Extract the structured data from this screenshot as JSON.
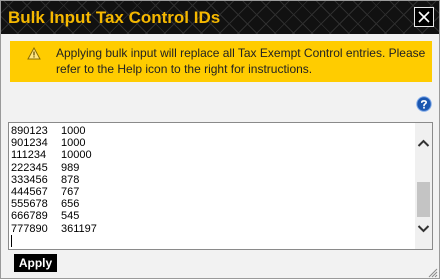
{
  "dialog": {
    "title": "Bulk Input Tax Control IDs",
    "close_icon": "close-icon"
  },
  "warning": {
    "icon": "warning-icon",
    "message": "Applying bulk input will replace all Tax Exempt Control entries. Please refer to the Help icon to the right for instructions."
  },
  "help": {
    "icon": "help-icon"
  },
  "entries": [
    {
      "id": "890123",
      "value": "1000"
    },
    {
      "id": "901234",
      "value": "1000"
    },
    {
      "id": "111234",
      "value": "10000"
    },
    {
      "id": "222345",
      "value": "989"
    },
    {
      "id": "333456",
      "value": "878"
    },
    {
      "id": "444567",
      "value": "767"
    },
    {
      "id": "555678",
      "value": "656"
    },
    {
      "id": "666789",
      "value": "545"
    },
    {
      "id": "777890",
      "value": "361197"
    }
  ],
  "scrollbar": {
    "up_icon": "chevron-up-icon",
    "down_icon": "chevron-down-icon"
  },
  "actions": {
    "apply_label": "Apply"
  },
  "colors": {
    "title_text": "#f5b800",
    "banner_background": "#ffcc00",
    "help_icon": "#1a56b0",
    "apply_background": "#000000"
  }
}
